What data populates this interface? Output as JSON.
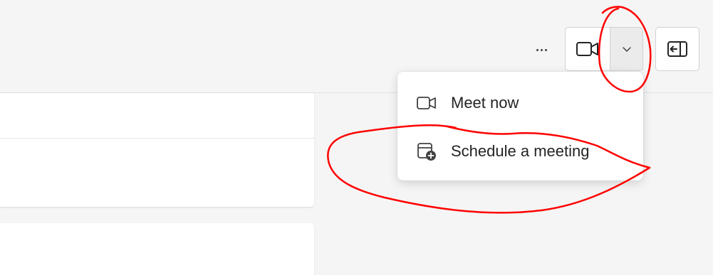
{
  "header": {
    "more_icon": "more-horizontal-icon",
    "video_icon": "video-camera-icon",
    "chevron_icon": "chevron-down-icon",
    "panel_icon": "panel-toggle-icon"
  },
  "dropdown": {
    "items": [
      {
        "label": "Meet now",
        "icon": "video-camera-icon"
      },
      {
        "label": "Schedule a meeting",
        "icon": "calendar-add-icon"
      }
    ]
  },
  "colors": {
    "background": "#f5f5f5",
    "surface": "#ffffff",
    "border": "#d1d1d1",
    "annotation": "#ff0000"
  }
}
